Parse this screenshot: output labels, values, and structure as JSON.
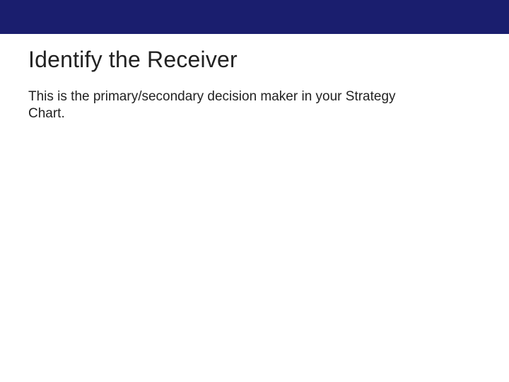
{
  "colors": {
    "band": "#1a1e6e",
    "text": "#222222",
    "background": "#ffffff"
  },
  "slide": {
    "title": "Identify the Receiver",
    "body": "This is the primary/secondary decision maker in your Strategy Chart."
  }
}
